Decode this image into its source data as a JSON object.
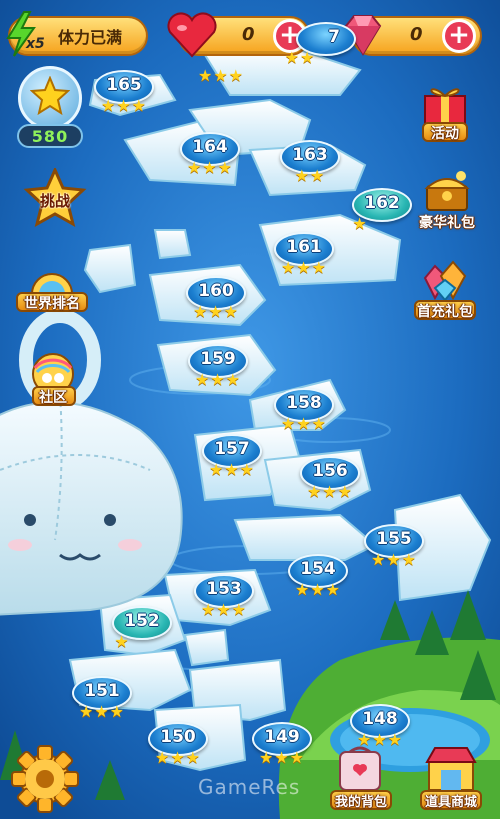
{
  "hud": {
    "energy_count": "x5",
    "energy_status": "体力已满",
    "hearts_count": "0",
    "gems_count": "0",
    "hearts_plus": "+",
    "gems_plus": "+"
  },
  "score": {
    "value": "580"
  },
  "left_menu": {
    "challenge": "挑战",
    "world_rank": "世界排名",
    "community": "社区"
  },
  "right_menu": {
    "activity": "活动",
    "luxury_gift": "豪华礼包",
    "first_charge_gift": "首充礼包"
  },
  "bottom_menu": {
    "backpack": "我的背包",
    "item_shop": "道具商城"
  },
  "partial_top_level": "7",
  "levels": [
    {
      "number": "165",
      "stars": 3
    },
    {
      "number": "164",
      "stars": 3
    },
    {
      "number": "163",
      "stars": 2
    },
    {
      "number": "162",
      "stars": 1
    },
    {
      "number": "161",
      "stars": 3
    },
    {
      "number": "160",
      "stars": 3
    },
    {
      "number": "159",
      "stars": 3
    },
    {
      "number": "158",
      "stars": 3
    },
    {
      "number": "157",
      "stars": 3
    },
    {
      "number": "156",
      "stars": 3
    },
    {
      "number": "155",
      "stars": 3
    },
    {
      "number": "154",
      "stars": 3
    },
    {
      "number": "153",
      "stars": 3
    },
    {
      "number": "152",
      "stars": 1
    },
    {
      "number": "151",
      "stars": 3
    },
    {
      "number": "150",
      "stars": 3
    },
    {
      "number": "149",
      "stars": 3
    },
    {
      "number": "148",
      "stars": 3
    }
  ],
  "watermark": "GameRes",
  "colors": {
    "water": "#1f6fbf",
    "ice": "#eaf6ff",
    "star": "#ffd21e",
    "node_blue": "#1c7fd0",
    "node_teal": "#29b6b3",
    "heart": "#e8283e",
    "gem": "#f0587a",
    "grass": "#5cbf3a"
  },
  "icons": {
    "energy": "lightning-icon",
    "heart": "heart-icon",
    "gem": "gem-icon",
    "score": "star-icon",
    "settings": "gear-icon"
  }
}
